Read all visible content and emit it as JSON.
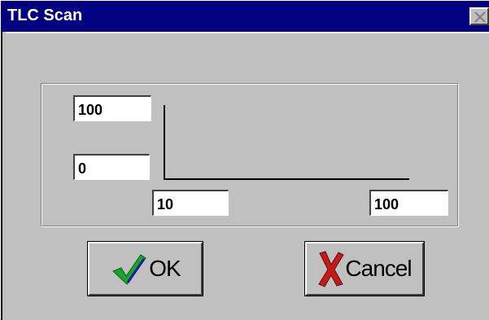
{
  "window": {
    "title": "TLC Scan"
  },
  "plot": {
    "y_max": "100",
    "y_min": "0",
    "x_min": "10",
    "x_max": "100"
  },
  "buttons": {
    "ok_label": "OK",
    "cancel_label": "Cancel"
  },
  "icons": {
    "ok": "green-checkmark-icon",
    "cancel": "red-x-icon",
    "close": "close-icon"
  },
  "colors": {
    "titlebar": "#000080",
    "face": "#c0c0c0",
    "check": "#1aa52a",
    "x": "#c41a1a"
  }
}
